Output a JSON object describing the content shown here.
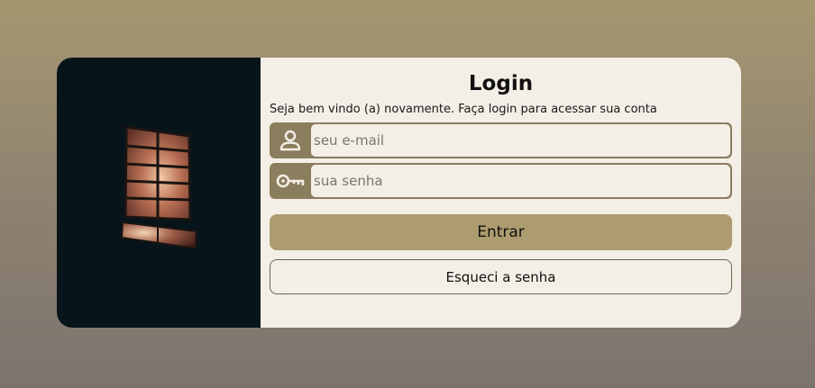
{
  "login": {
    "title": "Login",
    "subtitle": "Seja bem vindo (a) novamente. Faça login para acessar sua conta",
    "email": {
      "placeholder": "seu e-mail",
      "value": "",
      "icon": "user-icon"
    },
    "password": {
      "placeholder": "sua senha",
      "value": "",
      "icon": "key-icon"
    },
    "submit_label": "Entrar",
    "forgot_label": "Esqueci a senha"
  },
  "colors": {
    "accent": "#ad9c70",
    "field_frame": "#8b7e5f",
    "card_bg": "#f3eee6",
    "photo_bg": "#07141a"
  }
}
